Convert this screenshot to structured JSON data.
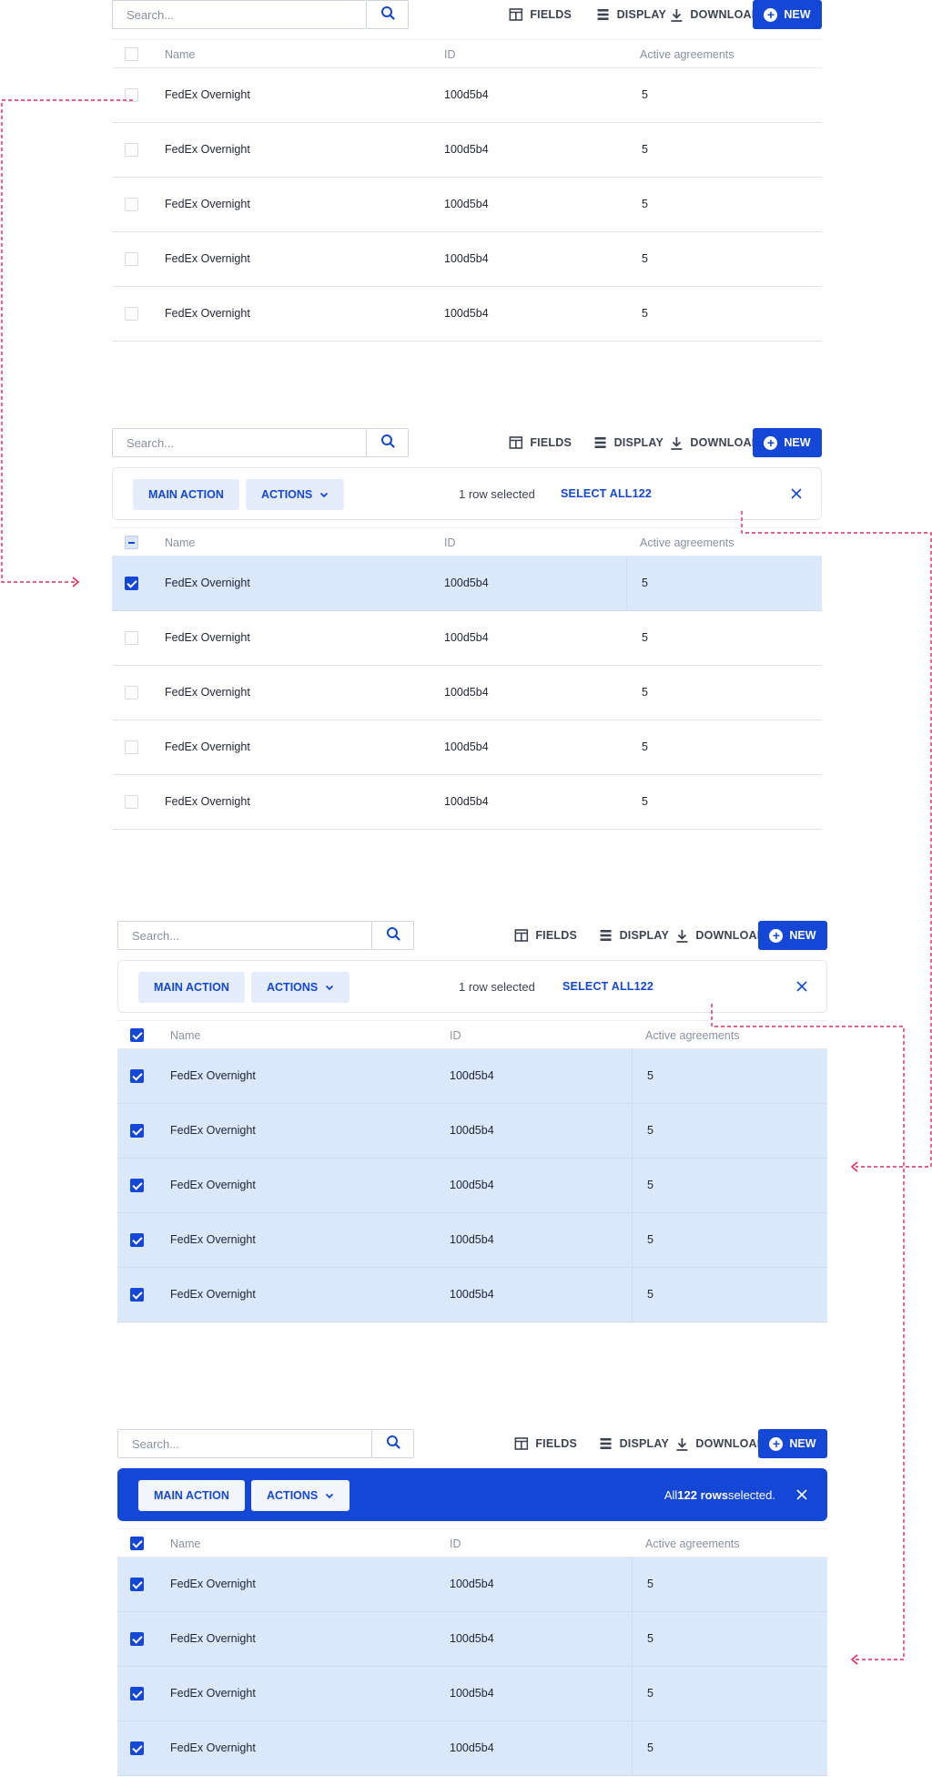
{
  "toolbar": {
    "search_placeholder": "Search...",
    "fields_label": "FIELDS",
    "display_label": "DISPLAY",
    "download_label": "DOWNLOAD",
    "new_label": "NEW"
  },
  "actionbar": {
    "main_action_label": "MAIN ACTION",
    "actions_label": "ACTIONS",
    "rows_selected_label": "1 row selected",
    "select_all_prefix": "SELECT ALL",
    "select_all_count": "122",
    "all_selected_prefix": "All",
    "all_selected_count": "122 rows",
    "all_selected_suffix": "selected."
  },
  "table": {
    "columns": [
      "Name",
      "ID",
      "Active agreements"
    ],
    "rows": [
      {
        "name": "FedEx Overnight",
        "id": "100d5b4",
        "active": "5"
      },
      {
        "name": "FedEx Overnight",
        "id": "100d5b4",
        "active": "5"
      },
      {
        "name": "FedEx Overnight",
        "id": "100d5b4",
        "active": "5"
      },
      {
        "name": "FedEx Overnight",
        "id": "100d5b4",
        "active": "5"
      },
      {
        "name": "FedEx Overnight",
        "id": "100d5b4",
        "active": "5"
      }
    ]
  },
  "colors": {
    "accent": "#1447d6",
    "selected_row": "#dbe7fb",
    "flow_arrow": "#e8295c"
  }
}
